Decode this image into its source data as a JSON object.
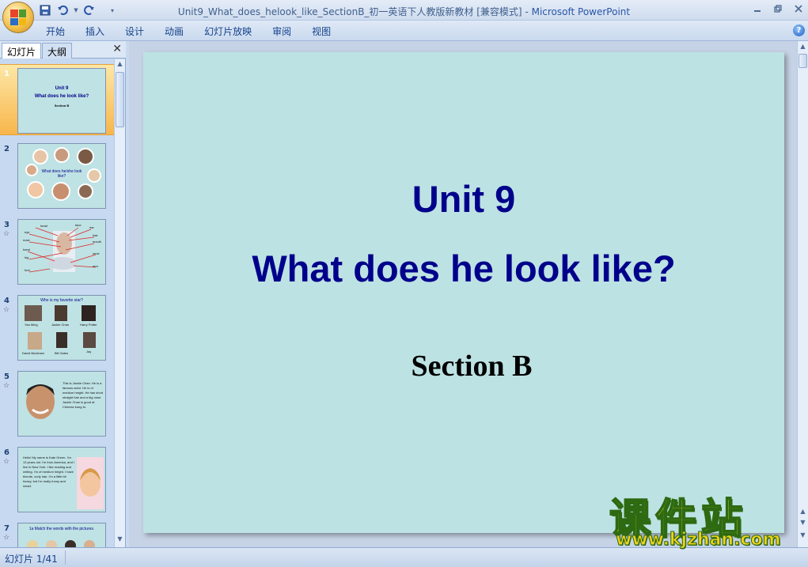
{
  "window": {
    "title": "Unit9_What_does_helook_like_SectionB_初一英语下人教版新教材 [兼容模式]",
    "title_separator": " - ",
    "app_name": "Microsoft PowerPoint"
  },
  "menu": [
    "开始",
    "插入",
    "设计",
    "动画",
    "幻灯片放映",
    "审阅",
    "视图"
  ],
  "pane": {
    "tab_slides": "幻灯片",
    "tab_outline": "大纲",
    "close": "✕"
  },
  "thumbnails": [
    {
      "num": "1",
      "title": "Unit 9",
      "subtitle": "What does he look like?",
      "section": "Section B"
    },
    {
      "num": "2",
      "text": "What does he/she look like?"
    },
    {
      "num": "3",
      "labels": [
        "head",
        "face",
        "ear",
        "eye",
        "nose",
        "hair",
        "mouth",
        "hand",
        "neck",
        "leg",
        "arm",
        "foot"
      ]
    },
    {
      "num": "4",
      "title": "Who is my favorite star?",
      "names": [
        "Yao Ming",
        "Jackie Chan",
        "Harry Potter",
        "David Beckham",
        "Bill Gates",
        "Jay"
      ]
    },
    {
      "num": "5",
      "text": "This is Jackie Chan. He is a famous actor. He is of medium height. He has short straight hair and a big nose. Jackie Chan is good at Chinese kung fu."
    },
    {
      "num": "6",
      "text": "Hello! My name is Kate Green. I'm 13 years old. I'm from America, and I live in New York. I like reading and writing. I'm of medium height. I have blonde, curly hair. I'm a little bit heavy, but I'm really funny and smart."
    },
    {
      "num": "7",
      "text": "1a Match the words with the pictures."
    }
  ],
  "slide": {
    "unit": "Unit 9",
    "title": "What does he look like?",
    "section": "Section B"
  },
  "watermark": {
    "cn": "课件站",
    "url": "www.kjzhan.com"
  },
  "status": {
    "slide_counter": "幻灯片 1/41"
  }
}
